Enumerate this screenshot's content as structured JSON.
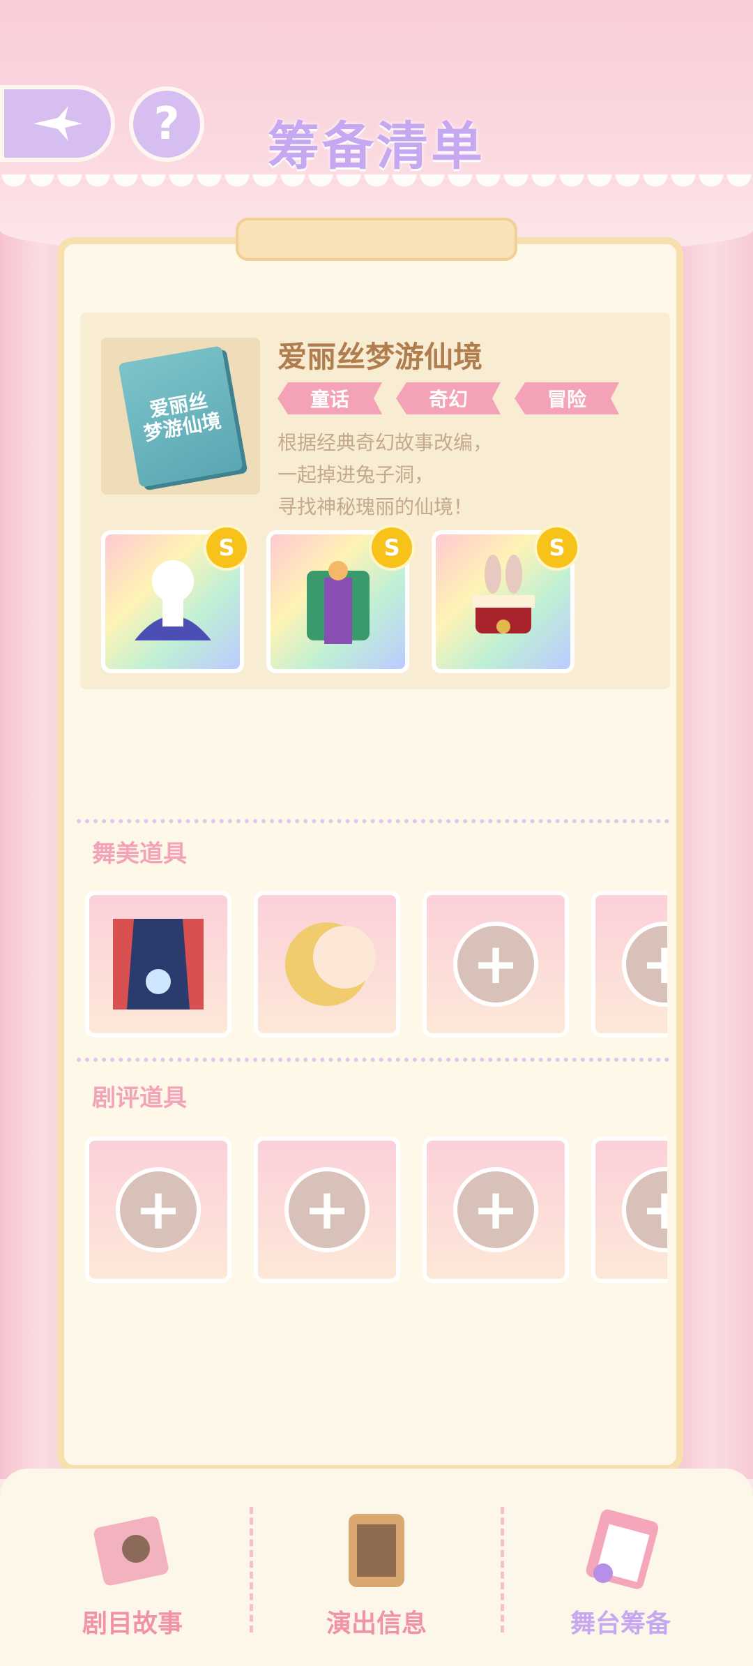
{
  "header": {
    "title": "筹备清单",
    "back_icon": "sparkle-back-icon",
    "help_label": "?"
  },
  "script": {
    "cover_text_1": "爱丽丝",
    "cover_text_2": "梦游仙境",
    "title": "爱丽丝梦游仙境",
    "tags": [
      "童话",
      "奇幻",
      "冒险"
    ],
    "description": [
      "根据经典奇幻故事改编，",
      "一起掉进兔子洞，",
      "寻找神秘瑰丽的仙境！"
    ],
    "outfits": [
      {
        "name": "blue-dress-outfit",
        "badge": "S"
      },
      {
        "name": "green-suit-outfit",
        "badge": "S"
      },
      {
        "name": "rabbit-hat-outfit",
        "badge": "S"
      }
    ]
  },
  "sections": {
    "stage_props": {
      "label": "舞美道具",
      "slots": [
        "stage-scene-prop",
        "moon-prop",
        "empty",
        "empty"
      ]
    },
    "review_props": {
      "label": "剧评道具",
      "slots": [
        "empty",
        "empty",
        "empty",
        "empty"
      ]
    }
  },
  "bottom_nav": {
    "items": [
      {
        "label": "剧目故事",
        "icon": "storybook-icon",
        "color": "#f092a8"
      },
      {
        "label": "演出信息",
        "icon": "info-board-icon",
        "color": "#f092a8"
      },
      {
        "label": "舞台筹备",
        "icon": "clipboard-icon",
        "color": "#c6a8f1",
        "active": true
      }
    ]
  },
  "colors": {
    "accent_purple": "#c6a8f1",
    "accent_pink": "#f092a8",
    "panel_bg": "#fdf8e8",
    "badge_gold": "#f7c21a"
  }
}
